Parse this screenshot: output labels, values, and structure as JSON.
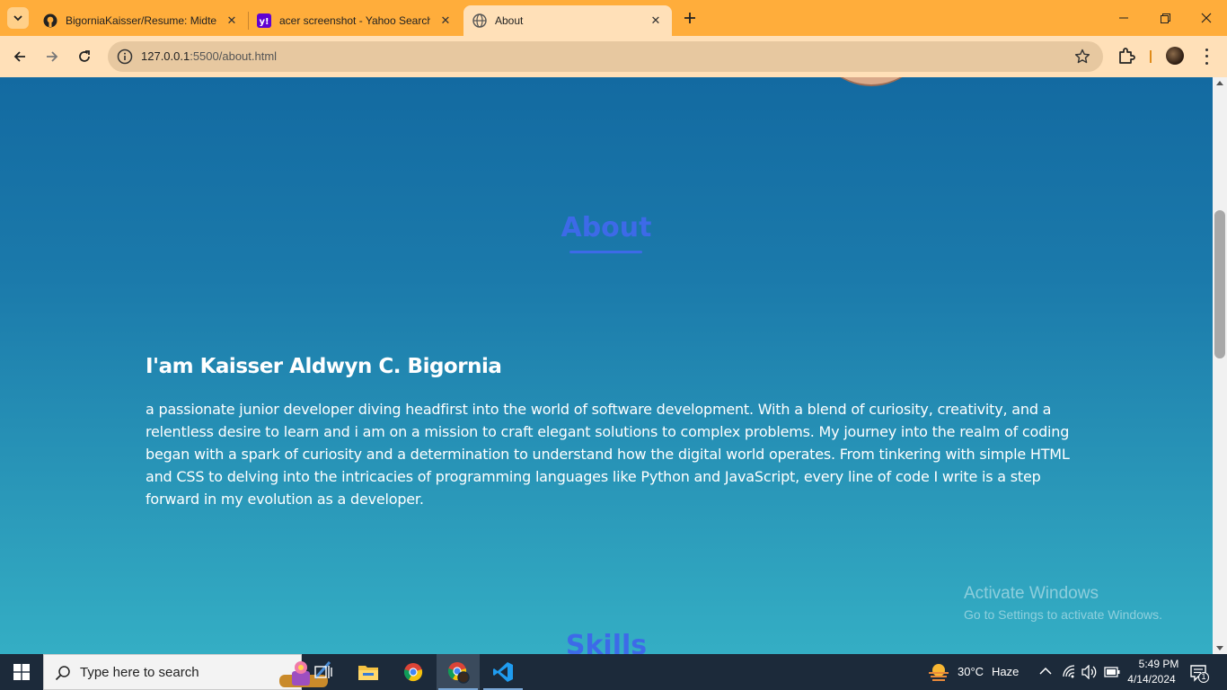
{
  "browser": {
    "tabs": [
      {
        "title": "BigorniaKaisser/Resume: Midte",
        "icon": "github-icon",
        "active": false
      },
      {
        "title": "acer screenshot - Yahoo Search",
        "icon": "yahoo-icon",
        "active": false
      },
      {
        "title": "About",
        "icon": "globe-icon",
        "active": true
      }
    ],
    "url_host": "127.0.0.1",
    "url_rest": ":5500/about.html"
  },
  "page": {
    "about_title": "About",
    "heading": "I'am Kaisser Aldwyn C. Bigornia",
    "body": "a passionate junior developer diving headfirst into the world of software development. With a blend of curiosity, creativity, and a relentless desire to learn and i am on a mission to craft elegant solutions to complex problems. My journey into the realm of coding began with a spark of curiosity and a determination to understand how the digital world operates. From tinkering with simple HTML and CSS to delving into the intricacies of programming languages like Python and JavaScript, every line of code I write is a step forward in my evolution as a developer.",
    "skills_title": "Skills",
    "accent_color": "#3d6ae8"
  },
  "watermark": {
    "line1": "Activate Windows",
    "line2": "Go to Settings to activate Windows."
  },
  "taskbar": {
    "search_placeholder": "Type here to search",
    "weather_temp": "30°C",
    "weather_desc": "Haze",
    "time": "5:49 PM",
    "date": "4/14/2024",
    "notification_count": "1"
  }
}
